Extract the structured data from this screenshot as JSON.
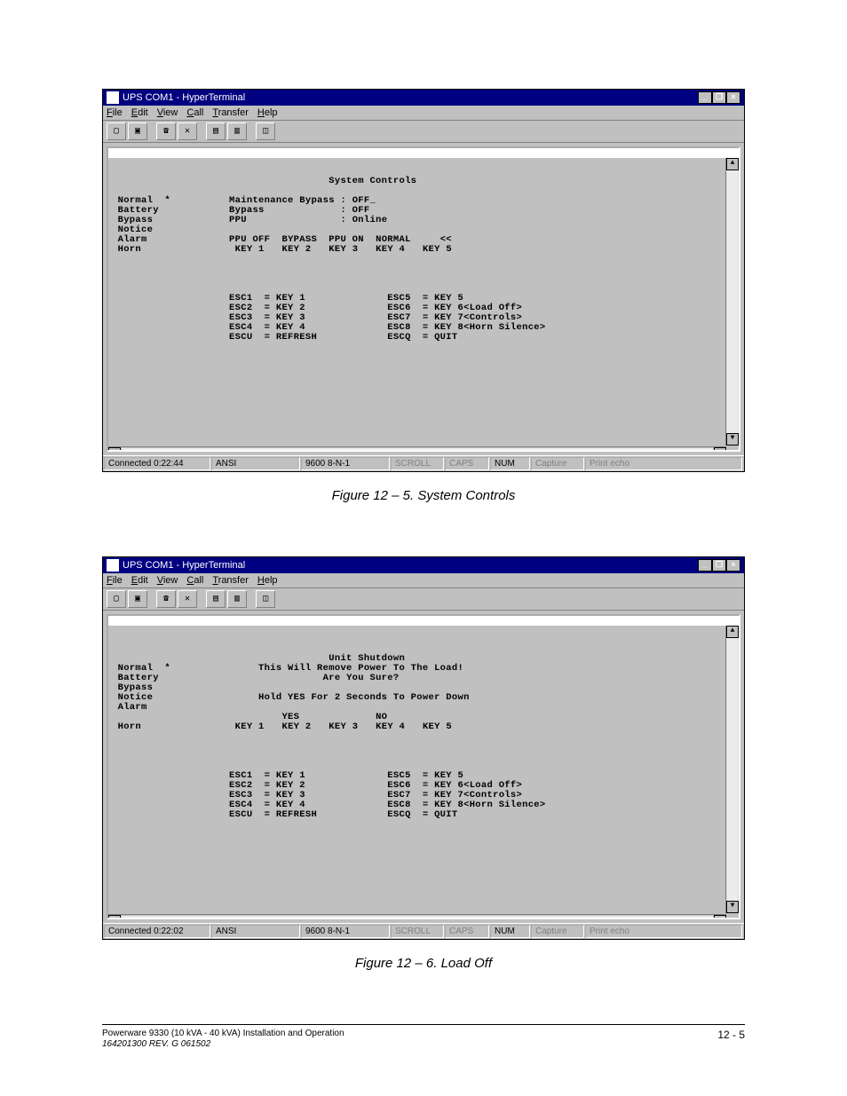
{
  "windows": {
    "title": "UPS COM1 - HyperTerminal",
    "menubar": [
      "File",
      "Edit",
      "View",
      "Call",
      "Transfer",
      "Help"
    ],
    "statusbar_common": {
      "encoding": "ANSI",
      "port": "9600 8-N-1",
      "scroll": "SCROLL",
      "caps": "CAPS",
      "num": "NUM",
      "capture": "Capture",
      "printecho": "Print echo"
    }
  },
  "figure1": {
    "caption": "Figure 12 – 5. System Controls",
    "status_time": "Connected 0:22:44",
    "sidebar": [
      "Normal  *",
      "Battery",
      "Bypass",
      "Notice",
      "Alarm",
      "",
      "Horn"
    ],
    "screen_title": "System Controls",
    "params": [
      {
        "label": "Maintenance Bypass",
        "value": "OFF_"
      },
      {
        "label": "Bypass",
        "value": "OFF"
      },
      {
        "label": "PPU",
        "value": "Online"
      }
    ],
    "key_row_top": [
      "PPU OFF",
      "BYPASS",
      "PPU ON",
      "NORMAL",
      "   <<"
    ],
    "key_row_bot": [
      "KEY 1",
      "KEY 2",
      "KEY 3",
      "KEY 4",
      "KEY 5"
    ],
    "esc_left": [
      "ESC1  = KEY 1",
      "ESC2  = KEY 2",
      "ESC3  = KEY 3",
      "ESC4  = KEY 4",
      "ESCU  = REFRESH"
    ],
    "esc_right": [
      "ESC5  = KEY 5",
      "ESC6  = KEY 6<Load Off>",
      "ESC7  = KEY 7<Controls>",
      "ESC8  = KEY 8<Horn Silence>",
      "ESCQ  = QUIT"
    ]
  },
  "figure2": {
    "caption": "Figure 12 – 6. Load Off",
    "status_time": "Connected 0:22:02",
    "sidebar": [
      "Normal  *",
      "Battery",
      "Bypass",
      "Notice",
      "Alarm",
      "",
      "Horn"
    ],
    "screen_title": "Unit Shutdown",
    "warning1": "This Will Remove Power To The Load!",
    "warning2": "Are You Sure?",
    "warning3": "Hold YES For 2 Seconds To Power Down",
    "key_row_top": [
      "",
      "YES",
      "",
      "NO",
      ""
    ],
    "key_row_bot": [
      "KEY 1",
      "KEY 2",
      "KEY 3",
      "KEY 4",
      "KEY 5"
    ],
    "esc_left": [
      "ESC1  = KEY 1",
      "ESC2  = KEY 2",
      "ESC3  = KEY 3",
      "ESC4  = KEY 4",
      "ESCU  = REFRESH"
    ],
    "esc_right": [
      "ESC5  = KEY 5",
      "ESC6  = KEY 6<Load Off>",
      "ESC7  = KEY 7<Controls>",
      "ESC8  = KEY 8<Horn Silence>",
      "ESCQ  = QUIT"
    ]
  },
  "footer": {
    "line1": "Powerware 9330 (10 kVA - 40 kVA) Installation and Operation",
    "line2": "164201300 REV. G  061502",
    "page": "12 - 5"
  }
}
